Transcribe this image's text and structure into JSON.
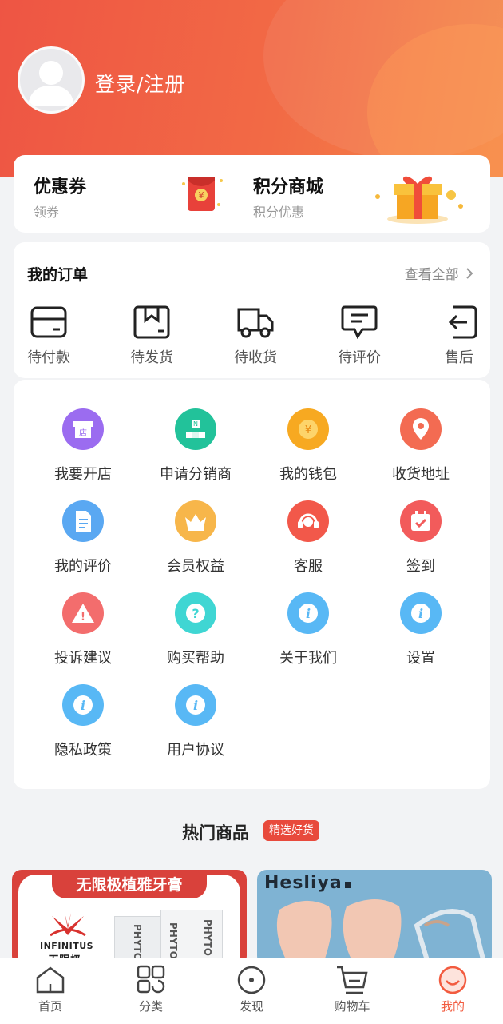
{
  "header": {
    "login_label": "登录/注册"
  },
  "promo": {
    "coupon": {
      "title": "优惠券",
      "subtitle": "领券"
    },
    "points": {
      "title": "积分商城",
      "subtitle": "积分优惠"
    },
    "red_packet_symbol": "¥"
  },
  "orders": {
    "title": "我的订单",
    "view_all": "查看全部",
    "items": [
      {
        "label": "待付款",
        "icon": "wallet-icon"
      },
      {
        "label": "待发货",
        "icon": "box-icon"
      },
      {
        "label": "待收货",
        "icon": "truck-icon"
      },
      {
        "label": "待评价",
        "icon": "comment-icon"
      },
      {
        "label": "售后",
        "icon": "return-icon"
      }
    ]
  },
  "services": {
    "items": [
      {
        "label": "我要开店",
        "icon": "shop-icon",
        "color": "#9b6cf0",
        "glyph": "店"
      },
      {
        "label": "申请分销商",
        "icon": "network-icon",
        "color": "#22c29a",
        "glyph": "N"
      },
      {
        "label": "我的钱包",
        "icon": "wallet-coin-icon",
        "color": "#f7a921",
        "glyph": "¥"
      },
      {
        "label": "收货地址",
        "icon": "location-icon",
        "color": "#f36b52",
        "glyph": ""
      },
      {
        "label": "我的评价",
        "icon": "document-icon",
        "color": "#5aa8f2",
        "glyph": ""
      },
      {
        "label": "会员权益",
        "icon": "crown-icon",
        "color": "#f7b64a",
        "glyph": ""
      },
      {
        "label": "客服",
        "icon": "headset-icon",
        "color": "#f2584a",
        "glyph": ""
      },
      {
        "label": "签到",
        "icon": "calendar-check-icon",
        "color": "#f25b5b",
        "glyph": ""
      },
      {
        "label": "投诉建议",
        "icon": "warning-icon",
        "color": "#f36d6d",
        "glyph": "!"
      },
      {
        "label": "购买帮助",
        "icon": "help-icon",
        "color": "#3fd6d3",
        "glyph": "?"
      },
      {
        "label": "关于我们",
        "icon": "info-icon",
        "color": "#58b8f5",
        "glyph": "i"
      },
      {
        "label": "设置",
        "icon": "info-icon",
        "color": "#58b8f5",
        "glyph": "i"
      },
      {
        "label": "隐私政策",
        "icon": "info-icon",
        "color": "#58b8f5",
        "glyph": "i"
      },
      {
        "label": "用户协议",
        "icon": "info-icon",
        "color": "#58b8f5",
        "glyph": "i"
      }
    ]
  },
  "hot": {
    "title": "热门商品",
    "badge": "精选好货",
    "products": [
      {
        "banner": "无限极植雅牙膏",
        "brand": "INFINITUS",
        "brand_cn": "无限极",
        "pack_text": "PHYTO"
      },
      {
        "brand": "Hesliya"
      }
    ]
  },
  "tabbar": {
    "items": [
      {
        "label": "首页",
        "icon": "home-icon"
      },
      {
        "label": "分类",
        "icon": "category-icon"
      },
      {
        "label": "发现",
        "icon": "discover-icon"
      },
      {
        "label": "购物车",
        "icon": "cart-icon"
      },
      {
        "label": "我的",
        "icon": "profile-icon"
      }
    ],
    "active_color": "#f25b3f"
  }
}
